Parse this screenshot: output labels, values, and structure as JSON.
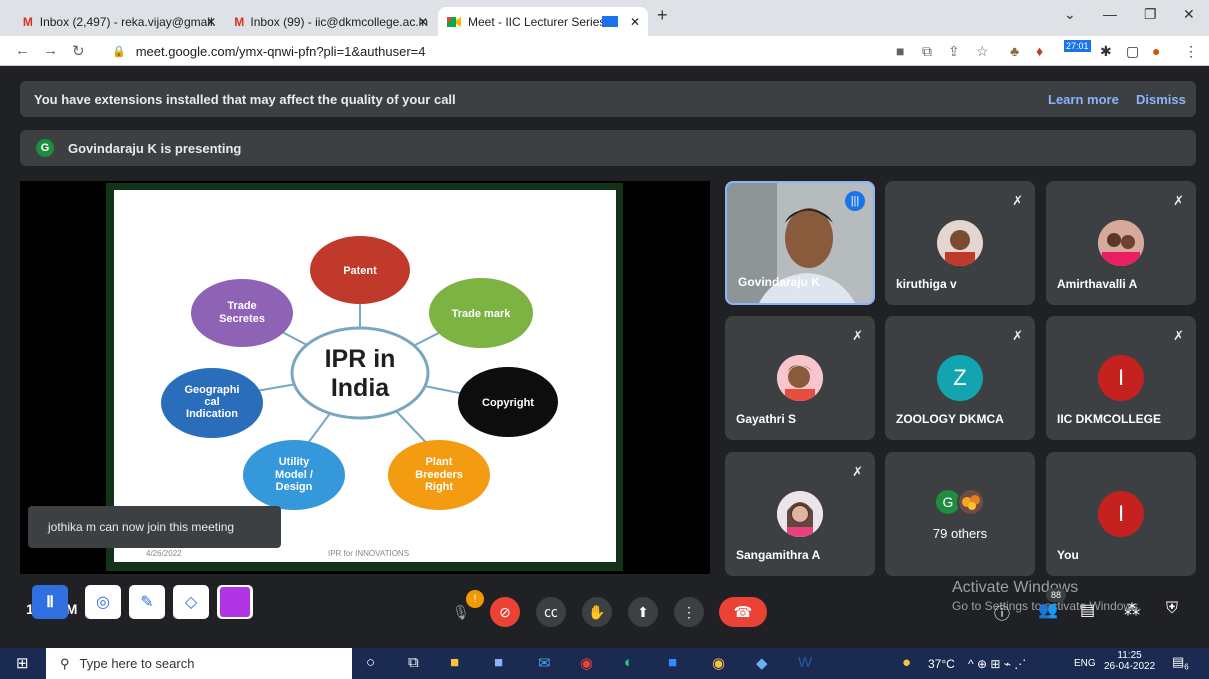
{
  "tabs": [
    {
      "icon": "gmail-icon",
      "title": "Inbox (2,497) - reka.vijay@gmail.",
      "close": "✕"
    },
    {
      "icon": "gmail-icon",
      "title": "Inbox (99) - iic@dkmcollege.ac.in",
      "close": "✕"
    },
    {
      "icon": "meet-icon",
      "title": "Meet - IIC Lecturer Series",
      "close": "✕"
    }
  ],
  "new_tab": "+",
  "address": {
    "url": "meet.google.com/ymx-qnwi-pfn?pli=1&authuser=4"
  },
  "extension_badge": "27:01",
  "banner": {
    "text": "You have extensions installed that may affect the quality of your call",
    "learn_more": "Learn more",
    "dismiss": "Dismiss"
  },
  "presenting": {
    "avatar": "G",
    "text": "Govindaraju K is presenting"
  },
  "slide": {
    "center": "IPR in India",
    "center_l1": "IPR in",
    "center_l2": "India",
    "bubbles": [
      "Patent",
      "Trade mark",
      "Copyright",
      "Plant Breeders Right",
      "Utility Model / Design",
      "Geographical Indication",
      "Trade Secretes"
    ],
    "b1": "Patent",
    "b2": "Trade mark",
    "b3": "Copyright",
    "b4a": "Plant",
    "b4b": "Breeders",
    "b4c": "Right",
    "b5a": "Utility",
    "b5b": "Model /",
    "b5c": "Design",
    "b6a": "Geographi",
    "b6b": "cal",
    "b6c": "Indication",
    "b7a": "Trade",
    "b7b": "Secretes",
    "date": "4/26/2022",
    "footer": "IPR for INNOVATIONS"
  },
  "toast": "jothika m can now join this meeting",
  "participants": [
    {
      "name": "Govindaraju K"
    },
    {
      "name": "kiruthiga v"
    },
    {
      "name": "Amirthavalli A"
    },
    {
      "name": "Gayathri S"
    },
    {
      "name": "ZOOLOGY DKMCA",
      "avatar": "Z"
    },
    {
      "name": "IIC DKMCOLLEGE",
      "avatar": "I"
    },
    {
      "name": "Sangamithra A"
    },
    {
      "name": "79 others",
      "avatar": "G"
    },
    {
      "name": "You",
      "avatar": "I"
    }
  ],
  "meeting_info": "1",
  "meeting_time": "AM",
  "participant_count": "88",
  "activate": {
    "line1": "Activate Windows",
    "line2": "Go to Settings to activate Windows."
  },
  "taskbar": {
    "search": "Type here to search",
    "temp": "37°C",
    "lang": "ENG",
    "time": "11:25",
    "date": "26-04-2022",
    "notif": "6"
  }
}
